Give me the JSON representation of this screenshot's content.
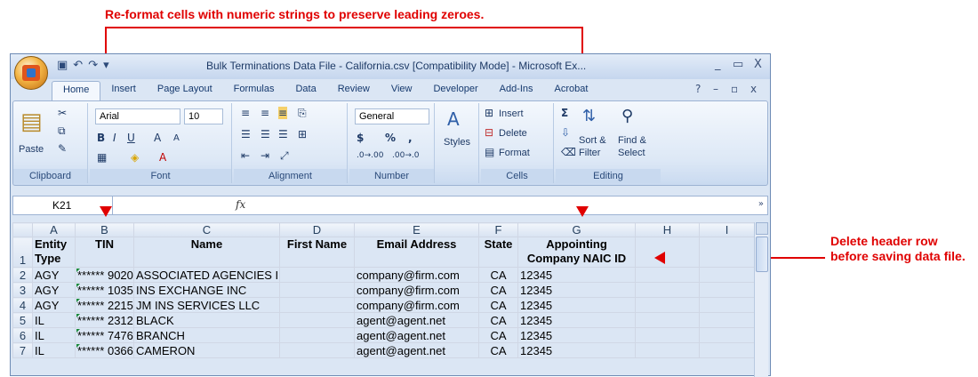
{
  "annotations": {
    "top_note": "Re-format cells with numeric strings to preserve leading zeroes.",
    "right_note": "Delete header row before saving data file."
  },
  "window": {
    "title": "Bulk Terminations Data File - California.csv  [Compatibility Mode] - Microsoft Ex...",
    "controls": [
      "_",
      "▭",
      "X"
    ]
  },
  "tabs": [
    "Home",
    "Insert",
    "Page Layout",
    "Formulas",
    "Data",
    "Review",
    "View",
    "Developer",
    "Add-Ins",
    "Acrobat"
  ],
  "ribbon": {
    "clipboard": {
      "label": "Clipboard",
      "paste": "Paste"
    },
    "font": {
      "label": "Font",
      "name": "Arial",
      "size": "10"
    },
    "alignment": {
      "label": "Alignment"
    },
    "number": {
      "label": "Number",
      "format": "General",
      "currency": "$",
      "percent": "%",
      "comma": ","
    },
    "styles": {
      "label": "Styles"
    },
    "cells": {
      "label": "Cells",
      "insert": "Insert",
      "delete": "Delete",
      "format": "Format"
    },
    "editing": {
      "label": "Editing",
      "sort": "Sort &",
      "filter": "Filter",
      "find": "Find &",
      "select": "Select"
    }
  },
  "formula_bar": {
    "cell_ref": "K21",
    "fx": "fx",
    "value": ""
  },
  "sheet": {
    "columns": [
      "A",
      "B",
      "C",
      "D",
      "E",
      "F",
      "G",
      "H",
      "I"
    ],
    "header_row": {
      "row_num": "1",
      "cells": [
        "Entity Type",
        "TIN",
        "Name",
        "First Name",
        "Email Address",
        "State",
        "Appointing Company NAIC ID",
        "",
        ""
      ]
    },
    "rows": [
      {
        "row_num": "2",
        "entity": "AGY",
        "tin": "****** 9020",
        "name": "ASSOCIATED AGENCIES INC",
        "first": "",
        "email": "company@firm.com",
        "state": "CA",
        "naic": "12345"
      },
      {
        "row_num": "3",
        "entity": "AGY",
        "tin": "****** 1035",
        "name": "INS EXCHANGE INC",
        "first": "",
        "email": "company@firm.com",
        "state": "CA",
        "naic": "12345"
      },
      {
        "row_num": "4",
        "entity": "AGY",
        "tin": "****** 2215",
        "name": "JM INS SERVICES LLC",
        "first": "",
        "email": "company@firm.com",
        "state": "CA",
        "naic": "12345"
      },
      {
        "row_num": "5",
        "entity": "IL",
        "tin": "****** 2312",
        "name": "BLACK",
        "first": "",
        "email": "agent@agent.net",
        "state": "CA",
        "naic": "12345"
      },
      {
        "row_num": "6",
        "entity": "IL",
        "tin": "****** 7476",
        "name": "BRANCH",
        "first": "",
        "email": "agent@agent.net",
        "state": "CA",
        "naic": "12345"
      },
      {
        "row_num": "7",
        "entity": "IL",
        "tin": "****** 0366",
        "name": "CAMERON",
        "first": "",
        "email": "agent@agent.net",
        "state": "CA",
        "naic": "12345"
      }
    ]
  },
  "colors": {
    "annotation": "#e00000",
    "ribbon": "#dbe6f4",
    "accent": "#1e3a66"
  }
}
